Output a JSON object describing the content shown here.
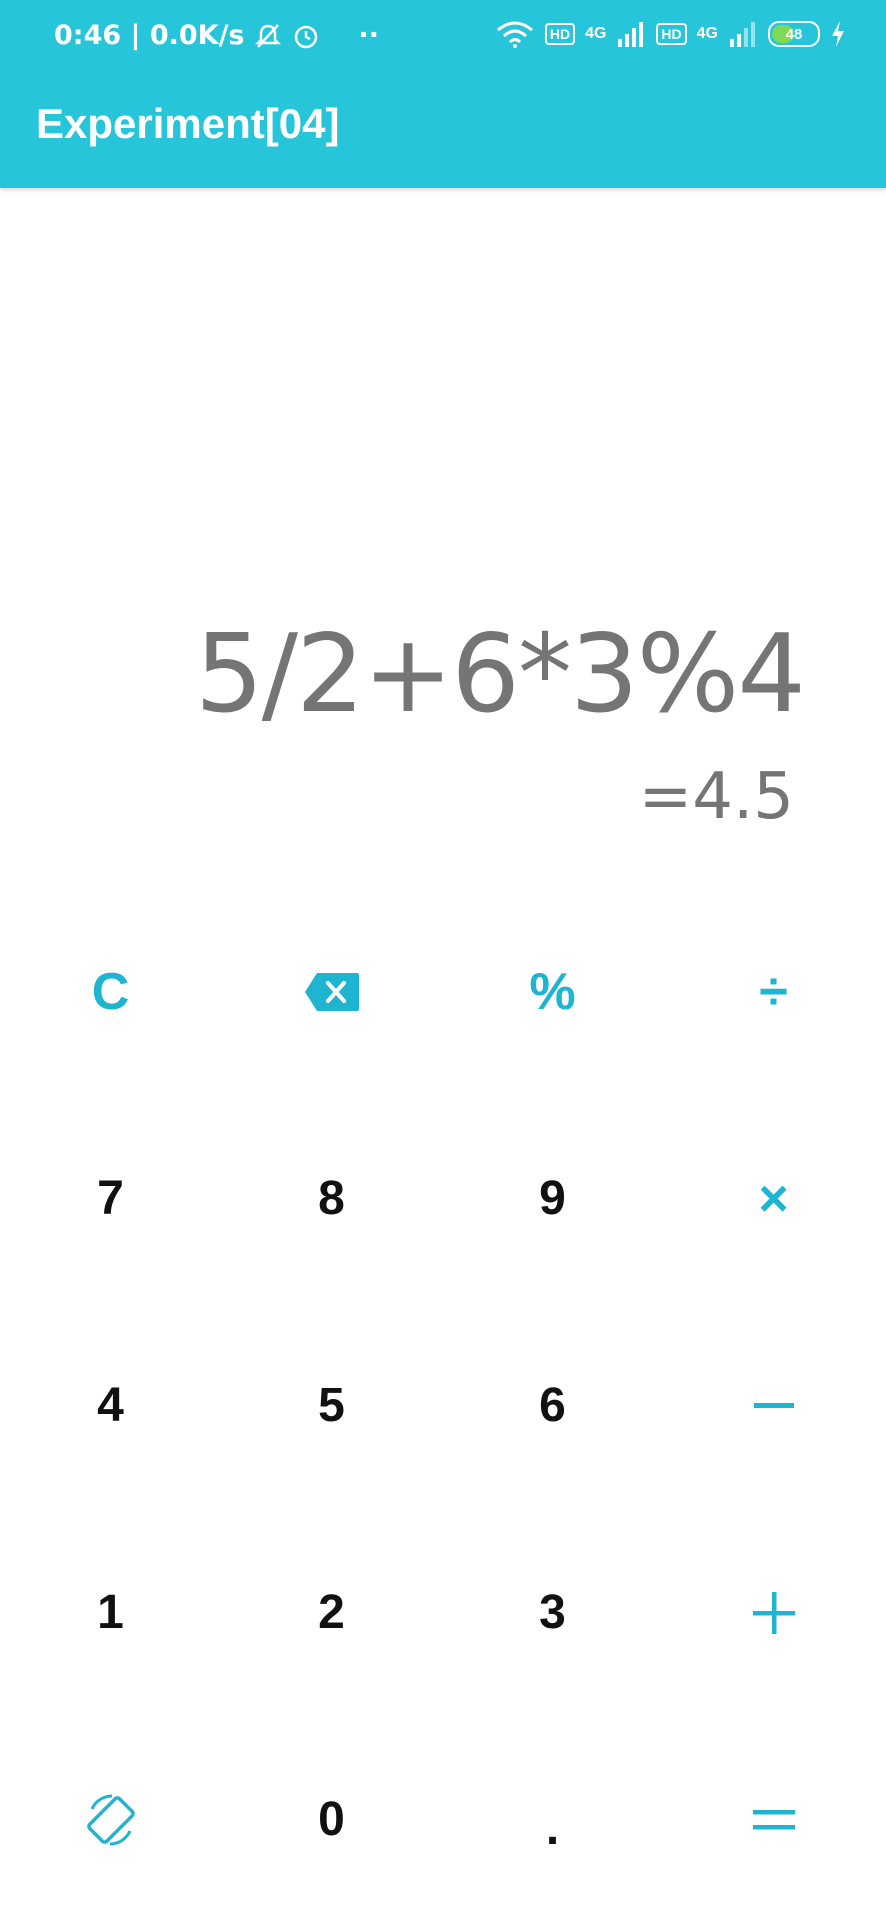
{
  "status_bar": {
    "time_speed": "0:46 | 0.0K/s",
    "more_dots": "··",
    "net1": "HD",
    "gen1": "4G",
    "net2": "HD",
    "gen2": "4G",
    "battery": "48",
    "icons": [
      "mute-icon",
      "alarm-icon",
      "wifi-icon",
      "signal-icon",
      "battery-icon",
      "charging-icon"
    ]
  },
  "app": {
    "title": "Experiment[04]"
  },
  "display": {
    "expression": "5/2+6*3%4",
    "result": "=4.5"
  },
  "keys": {
    "clear": "C",
    "percent": "%",
    "divide": "÷",
    "seven": "7",
    "eight": "8",
    "nine": "9",
    "multiply": "×",
    "four": "4",
    "five": "5",
    "six": "6",
    "one": "1",
    "two": "2",
    "three": "3",
    "zero": "0",
    "dot": "."
  },
  "colors": {
    "appbar": "#26c5da",
    "accent": "#1fb5d1",
    "display_text": "#757575"
  }
}
